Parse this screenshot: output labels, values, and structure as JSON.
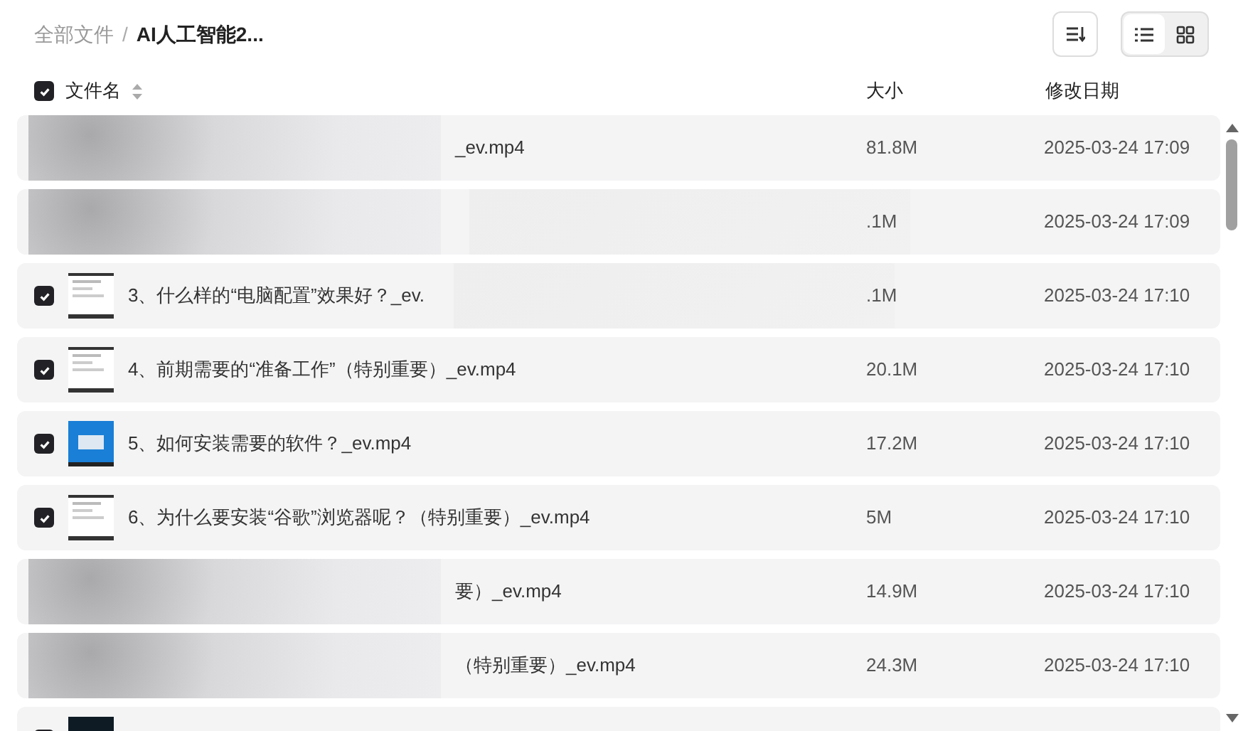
{
  "breadcrumb": {
    "separator": "/",
    "items": [
      {
        "label": "全部文件",
        "current": false
      },
      {
        "label": "AI人工智能2...",
        "current": true
      }
    ]
  },
  "views": [
    {
      "kind": "list",
      "selected": true
    },
    {
      "kind": "grid",
      "selected": false
    }
  ],
  "select_all": {
    "checked": true
  },
  "columns": [
    {
      "label": "文件名",
      "sortable": true
    },
    {
      "label": "大小",
      "sortable": false
    },
    {
      "label": "修改日期",
      "sortable": false
    }
  ],
  "rows": [
    {
      "kind": "covered",
      "blurred_left": true,
      "name": "_ev.mp4",
      "size": "81.8M",
      "modified": "2025-03-24 17:09"
    },
    {
      "kind": "covered",
      "blurred_left": true,
      "blurred_middle": true,
      "size": ".1M",
      "modified": "2025-03-24 17:09"
    },
    {
      "kind": "file",
      "blurred_middle": true,
      "checked": true,
      "thumbnail": {
        "kind": "light"
      },
      "name": "3、什么样的“电脑配置”效果好？_ev.",
      "size": ".1M",
      "modified": "2025-03-24 17:10"
    },
    {
      "kind": "file",
      "checked": true,
      "thumbnail": {
        "kind": "light"
      },
      "name": "4、前期需要的“准备工作”（特别重要）_ev.mp4",
      "size": "20.1M",
      "modified": "2025-03-24 17:10"
    },
    {
      "kind": "file",
      "checked": true,
      "thumbnail": {
        "kind": "blue"
      },
      "name": "5、如何安装需要的软件？_ev.mp4",
      "size": "17.2M",
      "modified": "2025-03-24 17:10"
    },
    {
      "kind": "file",
      "checked": true,
      "thumbnail": {
        "kind": "light"
      },
      "name": "6、为什么要安装“谷歌”浏览器呢？（特别重要）_ev.mp4",
      "size": "5M",
      "modified": "2025-03-24 17:10"
    },
    {
      "kind": "covered",
      "blurred_left": true,
      "name": "要）_ev.mp4",
      "size": "14.9M",
      "modified": "2025-03-24 17:10"
    },
    {
      "kind": "covered",
      "blurred_left": true,
      "name": "（特别重要）_ev.mp4",
      "size": "24.3M",
      "modified": "2025-03-24 17:10"
    },
    {
      "kind": "file",
      "checked": true,
      "thumbnail": {
        "kind": "dark"
      }
    }
  ]
}
